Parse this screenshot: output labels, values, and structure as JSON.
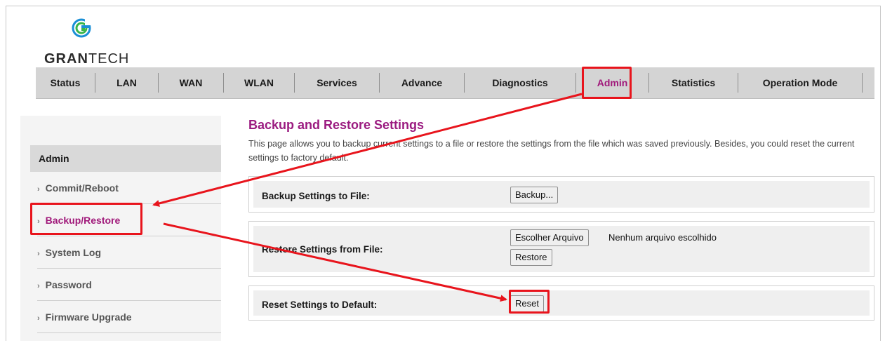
{
  "brand": {
    "logo_text_bold": "GRAN",
    "logo_text_rest": "TECH",
    "accent": "#a0197a",
    "highlight": "#e8141c",
    "logo_icon": "grantech-logo-icon"
  },
  "nav": {
    "items": [
      "Status",
      "LAN",
      "WAN",
      "WLAN",
      "Services",
      "Advance",
      "Diagnostics",
      "Admin",
      "Statistics",
      "Operation Mode"
    ],
    "active": "Admin"
  },
  "sidebar": {
    "header": "Admin",
    "items": [
      "Commit/Reboot",
      "Backup/Restore",
      "System Log",
      "Password",
      "Firmware Upgrade"
    ],
    "active": "Backup/Restore"
  },
  "main": {
    "title": "Backup and Restore Settings",
    "description": "This page allows you to backup current settings to a file or restore the settings from the file which was saved previously. Besides, you could reset the current settings to factory default.",
    "backup": {
      "label": "Backup Settings to File:",
      "button": "Backup..."
    },
    "restore": {
      "label": "Restore Settings from File:",
      "choose_button": "Escolher Arquivo",
      "file_status": "Nenhum arquivo escolhido",
      "button": "Restore"
    },
    "reset": {
      "label": "Reset Settings to Default:",
      "button": "Reset"
    }
  }
}
